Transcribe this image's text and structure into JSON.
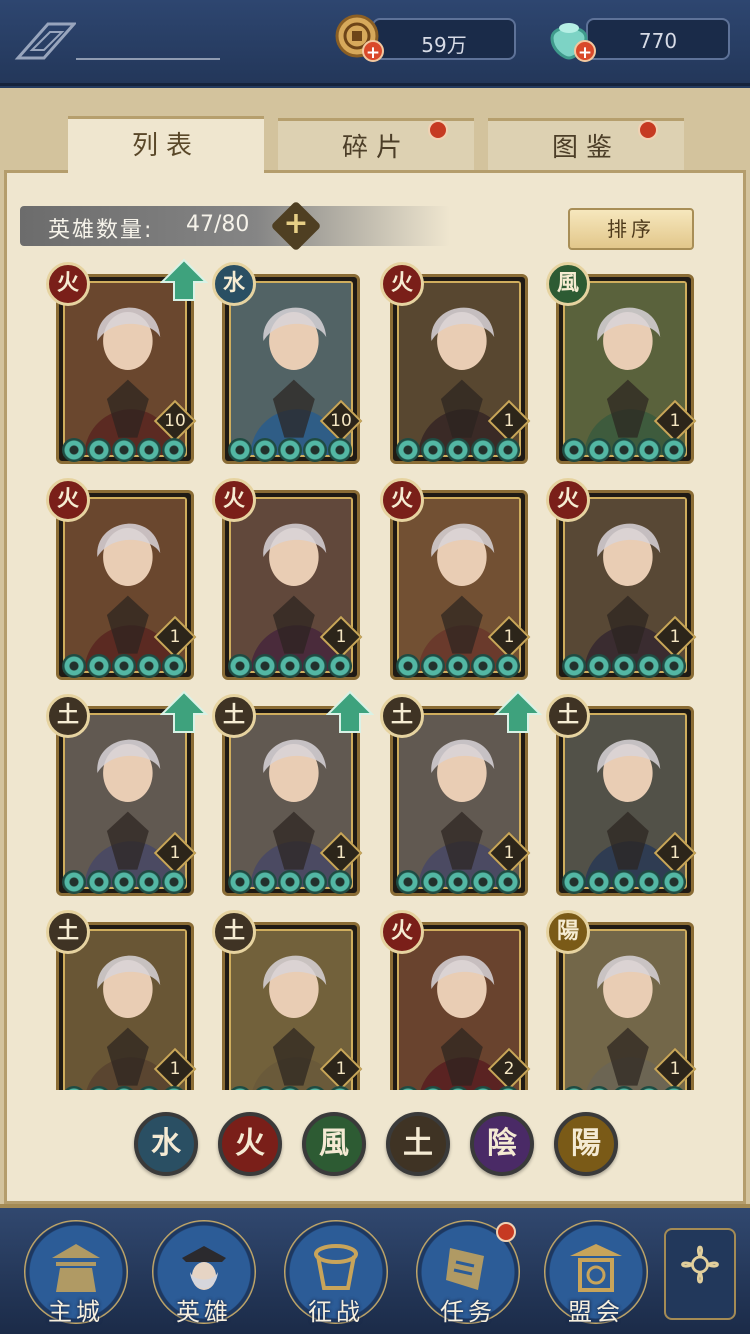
{
  "resources": {
    "coins": "59万",
    "jade": "770"
  },
  "tabs": [
    {
      "label": "列表",
      "active": true,
      "has_dot": false
    },
    {
      "label": "碎片",
      "active": false,
      "has_dot": true
    },
    {
      "label": "图鉴",
      "active": false,
      "has_dot": true
    }
  ],
  "hero_count": {
    "label": "英雄数量:",
    "value": "47/80"
  },
  "sort_label": "排序",
  "heroes": [
    {
      "element": "火",
      "element_color": "#7a1f19",
      "level": "10",
      "upgradable": true
    },
    {
      "element": "水",
      "element_color": "#2a4f63",
      "level": "10",
      "upgradable": false
    },
    {
      "element": "火",
      "element_color": "#7a1f19",
      "level": "1",
      "upgradable": false
    },
    {
      "element": "風",
      "element_color": "#2d5b33",
      "level": "1",
      "upgradable": false
    },
    {
      "element": "火",
      "element_color": "#7a1f19",
      "level": "1",
      "upgradable": false
    },
    {
      "element": "火",
      "element_color": "#7a1f19",
      "level": "1",
      "upgradable": false
    },
    {
      "element": "火",
      "element_color": "#7a1f19",
      "level": "1",
      "upgradable": false
    },
    {
      "element": "火",
      "element_color": "#7a1f19",
      "level": "1",
      "upgradable": false
    },
    {
      "element": "土",
      "element_color": "#3f3324",
      "level": "1",
      "upgradable": true
    },
    {
      "element": "土",
      "element_color": "#3f3324",
      "level": "1",
      "upgradable": true
    },
    {
      "element": "土",
      "element_color": "#3f3324",
      "level": "1",
      "upgradable": true
    },
    {
      "element": "土",
      "element_color": "#3f3324",
      "level": "1",
      "upgradable": false
    },
    {
      "element": "土",
      "element_color": "#3f3324",
      "level": "1",
      "upgradable": false
    },
    {
      "element": "土",
      "element_color": "#3f3324",
      "level": "1",
      "upgradable": false
    },
    {
      "element": "火",
      "element_color": "#7a1f19",
      "level": "2",
      "upgradable": false
    },
    {
      "element": "陽",
      "element_color": "#7a5a17",
      "level": "1",
      "upgradable": false
    }
  ],
  "element_filters": [
    {
      "label": "水",
      "color": "#2a4f63"
    },
    {
      "label": "火",
      "color": "#7a1f19"
    },
    {
      "label": "風",
      "color": "#2d5b33"
    },
    {
      "label": "土",
      "color": "#3f3324"
    },
    {
      "label": "陰",
      "color": "#4a2a66"
    },
    {
      "label": "陽",
      "color": "#7a5a17"
    }
  ],
  "nav": [
    {
      "label": "主城",
      "icon": "palace-icon",
      "has_dot": false
    },
    {
      "label": "英雄",
      "icon": "hero-icon",
      "has_dot": false
    },
    {
      "label": "征战",
      "icon": "drum-icon",
      "has_dot": false
    },
    {
      "label": "任务",
      "icon": "scroll-icon",
      "has_dot": true
    },
    {
      "label": "盟会",
      "icon": "pavilion-icon",
      "has_dot": false
    }
  ]
}
